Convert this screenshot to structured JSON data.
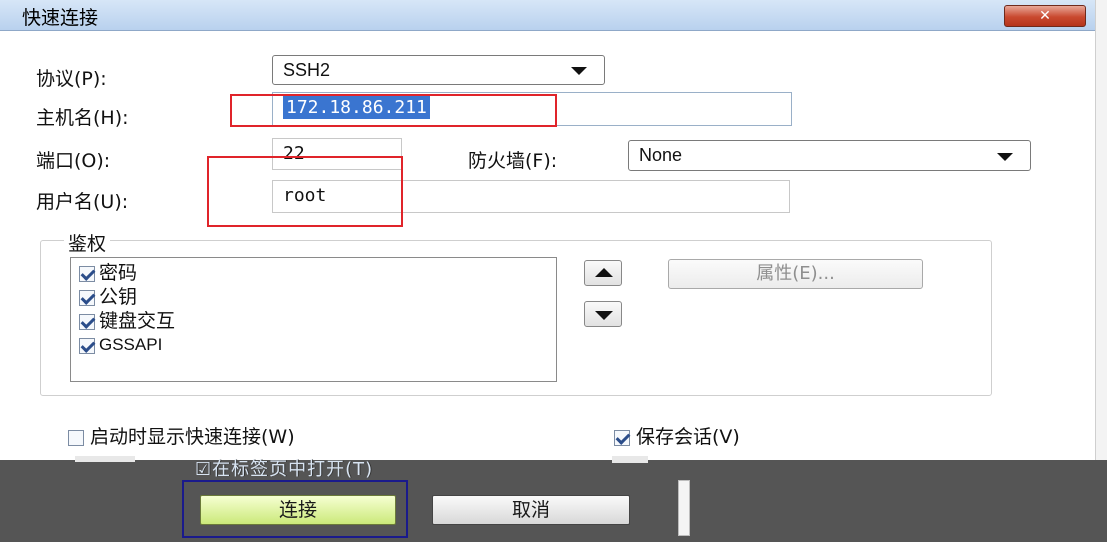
{
  "window": {
    "title": "快速连接",
    "close_glyph": "✕"
  },
  "form": {
    "protocol_label": "协议(P):",
    "protocol_value": "SSH2",
    "hostname_label": "主机名(H):",
    "hostname_value": "172.18.86.211",
    "port_label": "端口(O):",
    "port_value": "22",
    "firewall_label": "防火墙(F):",
    "firewall_value": "None",
    "username_label": "用户名(U):",
    "username_value": "root"
  },
  "auth": {
    "title": "鉴权",
    "items": [
      {
        "label": "密码",
        "checked": true
      },
      {
        "label": "公钥",
        "checked": true
      },
      {
        "label": "键盘交互",
        "checked": true
      },
      {
        "label": "GSSAPI",
        "checked": true
      }
    ],
    "properties_label": "属性(E)..."
  },
  "options": {
    "show_on_startup_label": "启动时显示快速连接(W)",
    "show_on_startup_checked": false,
    "save_session_label": "保存会话(V)",
    "save_session_checked": true,
    "open_in_tab_label": "在标签页中打开(T)",
    "open_in_tab_checked": true
  },
  "buttons": {
    "connect_label": "连接",
    "cancel_label": "取消"
  },
  "colors": {
    "selection": "#3a75d0",
    "annotation_red": "#e0242a",
    "connect_green": "#cbe97a",
    "footer_gray": "#555555"
  },
  "icons": [
    "close-icon",
    "chevron-down-icon",
    "arrow-up-icon",
    "arrow-down-icon",
    "checkbox-checked-icon",
    "checkbox-unchecked-icon"
  ]
}
